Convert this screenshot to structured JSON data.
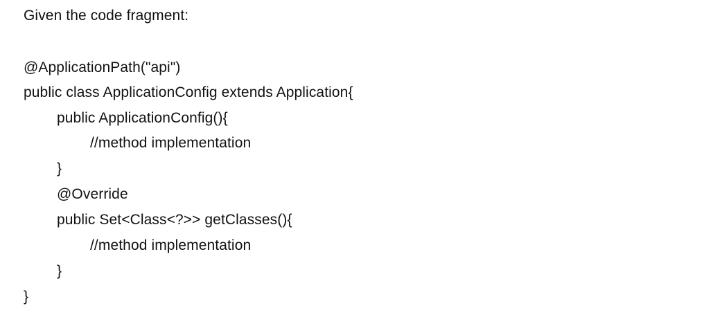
{
  "document": {
    "heading": "Given the code fragment:",
    "code_lines": [
      "@ApplicationPath(\"api\")",
      "public class ApplicationConfig extends Application{",
      "public ApplicationConfig(){",
      "//method implementation",
      "}",
      "@Override",
      "public Set<Class<?>> getClasses(){",
      "//method implementation",
      "}",
      "}"
    ]
  }
}
